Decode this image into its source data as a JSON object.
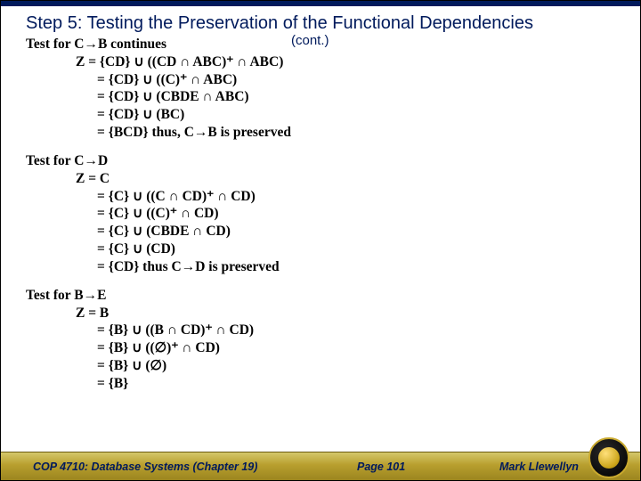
{
  "title": "Step 5: Testing the Preservation of the Functional Dependencies",
  "cont": "(cont.)",
  "blocks": [
    {
      "head": "Test for C→B continues",
      "lines": [
        "Z = {CD} ∪ ((CD ∩ ABC)⁺ ∩ ABC)",
        "= {CD} ∪ ((C)⁺ ∩ ABC)",
        "= {CD} ∪ (CBDE ∩ ABC)",
        "= {CD} ∪ (BC)",
        "= {BCD} thus, C→B is preserved"
      ]
    },
    {
      "head": "Test for C→D",
      "lines": [
        "Z = C",
        "= {C} ∪ ((C ∩ CD)⁺ ∩ CD)",
        "= {C} ∪ ((C)⁺ ∩ CD)",
        "= {C} ∪ (CBDE ∩ CD)",
        "= {C} ∪ (CD)",
        "= {CD} thus C→D is preserved"
      ]
    },
    {
      "head": "Test for B→E",
      "lines": [
        "Z = B",
        "= {B} ∪ ((B ∩ CD)⁺ ∩ CD)",
        "= {B} ∪ ((∅)⁺ ∩ CD)",
        "= {B} ∪ (∅)",
        "= {B}"
      ]
    }
  ],
  "footer": {
    "course": "COP 4710: Database Systems  (Chapter 19)",
    "page": "Page 101",
    "author": "Mark Llewellyn"
  }
}
